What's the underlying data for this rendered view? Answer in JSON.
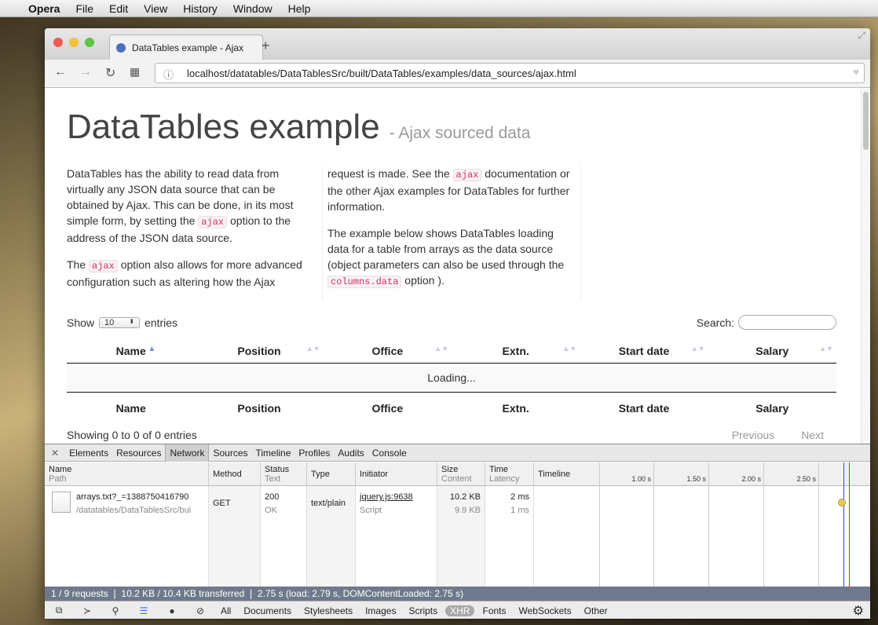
{
  "menubar": {
    "app": "Opera",
    "items": [
      "File",
      "Edit",
      "View",
      "History",
      "Window",
      "Help"
    ]
  },
  "browser": {
    "tab_title": "DataTables example - Ajax",
    "url": "localhost/datatables/DataTablesSrc/built/DataTables/examples/data_sources/ajax.html"
  },
  "page": {
    "title": "DataTables example",
    "subtitle": "- Ajax sourced data",
    "col1_p1": [
      "DataTables has the ability to read data from virtually any JSON data source that can be obtained by Ajax. This can be done, in its most simple form, by setting the ",
      "ajax",
      " option to the address of the JSON data source."
    ],
    "col1_p2": [
      "The ",
      "ajax",
      " option also allows for more advanced configuration such as altering how the Ajax"
    ],
    "col2_p1": [
      "request is made. See the ",
      "ajax",
      " documentation or the other Ajax examples for DataTables for further information."
    ],
    "col2_p2": [
      "The example below shows DataTables loading data for a table from arrays as the data source (object parameters can also be used through the ",
      "columns.data",
      " option )."
    ],
    "show_label": "Show",
    "entries_value": "10",
    "entries_label": "entries",
    "search_label": "Search:",
    "columns": [
      "Name",
      "Position",
      "Office",
      "Extn.",
      "Start date",
      "Salary"
    ],
    "loading": "Loading...",
    "info": "Showing 0 to 0 of 0 entries",
    "previous": "Previous",
    "next": "Next"
  },
  "devtools": {
    "tabs": [
      "Elements",
      "Resources",
      "Network",
      "Sources",
      "Timeline",
      "Profiles",
      "Audits",
      "Console"
    ],
    "active_tab": "Network",
    "headers": {
      "name": "Name",
      "path": "Path",
      "method": "Method",
      "status": "Status",
      "text": "Text",
      "type": "Type",
      "initiator": "Initiator",
      "size": "Size",
      "content": "Content",
      "time": "Time",
      "latency": "Latency",
      "timeline": "Timeline"
    },
    "timeline_ticks": [
      "1.00 s",
      "1.50 s",
      "2.00 s",
      "2.50 s"
    ],
    "request": {
      "name": "arrays.txt?_=1388750416790",
      "path": "/datatables/DataTablesSrc/bui",
      "method": "GET",
      "status": "200",
      "status_text": "OK",
      "type": "text/plain",
      "initiator": "jquery.js:9638",
      "initiator_type": "Script",
      "size": "10.2 KB",
      "content": "9.9 KB",
      "time": "2 ms",
      "latency": "1 ms"
    },
    "status_bar": "1 / 9 requests  ❘  10.2 KB / 10.4 KB transferred  ❘  2.75 s (load: 2.79 s, DOMContentLoaded: 2.75 s)",
    "filters": [
      "All",
      "Documents",
      "Stylesheets",
      "Images",
      "Scripts",
      "XHR",
      "Fonts",
      "WebSockets",
      "Other"
    ],
    "active_filter": "XHR"
  }
}
